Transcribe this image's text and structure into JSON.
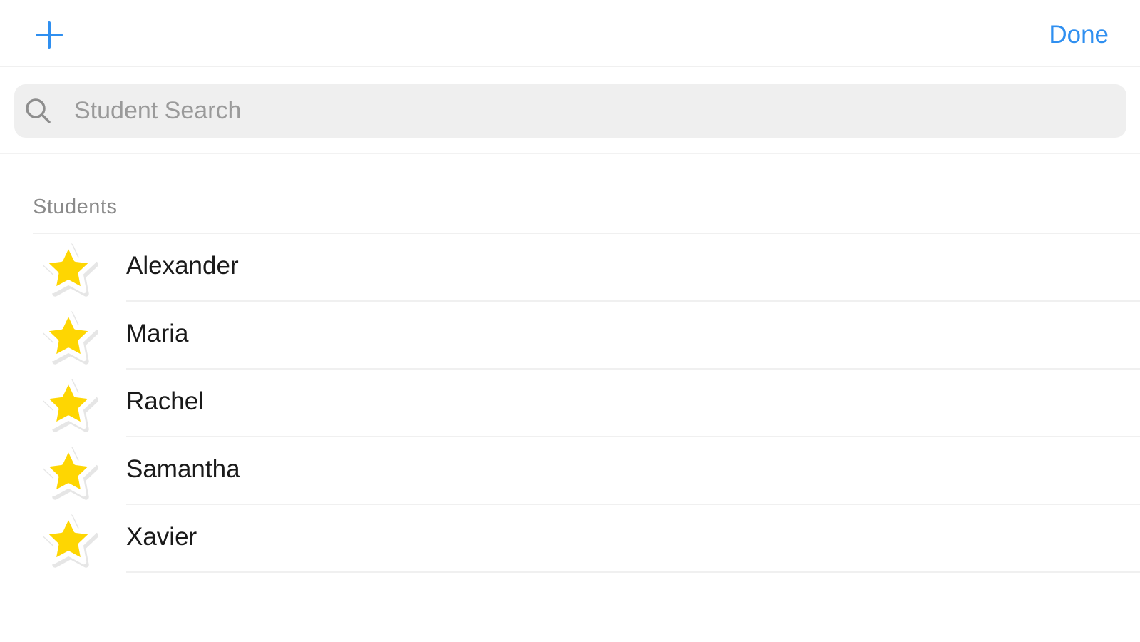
{
  "navbar": {
    "add_icon": "plus-icon",
    "done_label": "Done",
    "accent_color": "#2f8ff0"
  },
  "search": {
    "placeholder": "Student Search",
    "value": "",
    "icon": "search-icon"
  },
  "students_section": {
    "header": "Students",
    "items": [
      {
        "name": "Alexander",
        "icon": "star-icon"
      },
      {
        "name": "Maria",
        "icon": "star-icon"
      },
      {
        "name": "Rachel",
        "icon": "star-icon"
      },
      {
        "name": "Samantha",
        "icon": "star-icon"
      },
      {
        "name": "Xavier",
        "icon": "star-icon"
      }
    ]
  },
  "colors": {
    "star": "#fed602",
    "search_background": "#efefef"
  }
}
